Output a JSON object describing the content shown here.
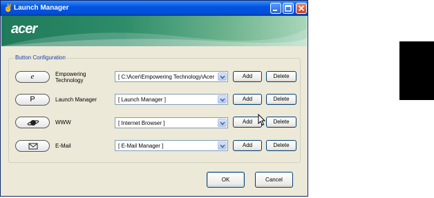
{
  "window": {
    "title": "Launch Manager",
    "logo_text": "acer"
  },
  "group": {
    "title": "Button Configuration"
  },
  "rows": [
    {
      "button_glyph": "e",
      "label_line1": "Empowering",
      "label_line2": "Technology",
      "combo_value": "[ C:\\Acer\\Empowering Technology\\Acer",
      "add_label": "Add",
      "delete_label": "Delete",
      "icon": "e-icon"
    },
    {
      "button_glyph": "P",
      "label_line1": "Launch Manager",
      "label_line2": "",
      "combo_value": "[ Launch Manager ]",
      "add_label": "Add",
      "delete_label": "Delete",
      "icon": "p-icon"
    },
    {
      "button_glyph": "",
      "label_line1": "WWW",
      "label_line2": "",
      "combo_value": "[ Internet Browser ]",
      "add_label": "Add",
      "delete_label": "Delete",
      "icon": "planet-icon"
    },
    {
      "button_glyph": "",
      "label_line1": "E-Mail",
      "label_line2": "",
      "combo_value": "[ E-Mail Manager ]",
      "add_label": "Add",
      "delete_label": "Delete",
      "icon": "envelope-icon"
    }
  ],
  "footer": {
    "ok_label": "OK",
    "cancel_label": "Cancel"
  },
  "colors": {
    "titlebar": "#0054e3",
    "banner": "#2d8c69",
    "window_bg": "#ece9d8"
  }
}
